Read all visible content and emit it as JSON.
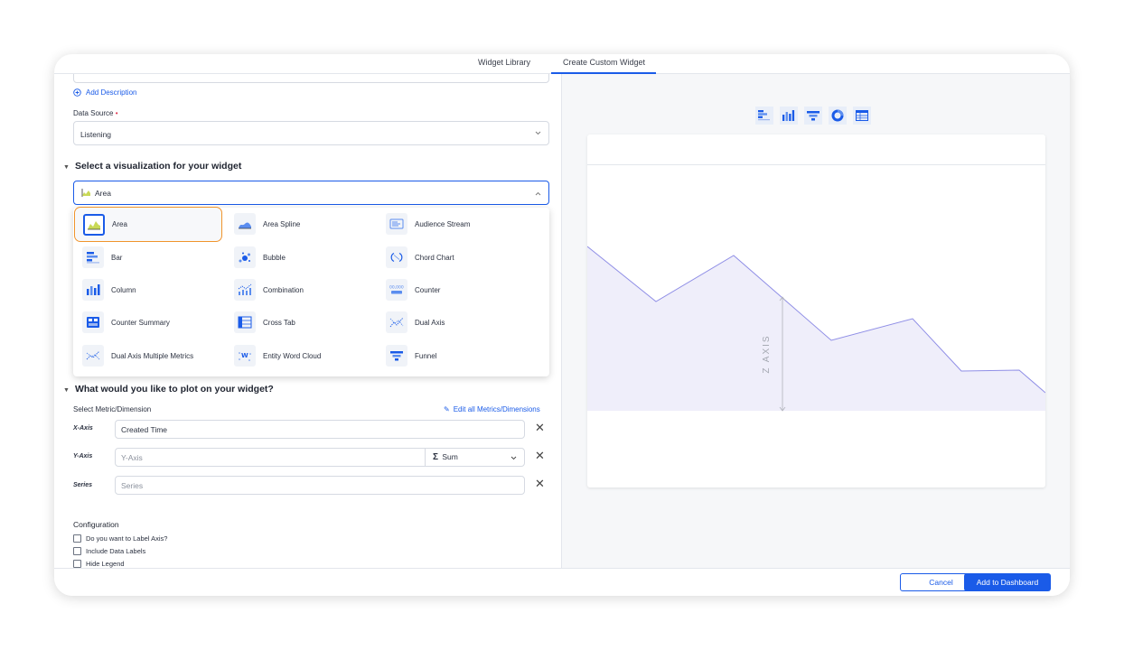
{
  "tabs": {
    "library": "Widget Library",
    "custom": "Create Custom Widget"
  },
  "form": {
    "add_description": "Add Description",
    "data_source_label": "Data Source",
    "data_source_required": "•",
    "data_source_value": "Listening",
    "viz_section_title": "Select a visualization for your widget",
    "viz_selected": "Area",
    "plot_section_title": "What would you like to plot on your widget?",
    "select_metric_label": "Select Metric/Dimension",
    "edit_all_link": "Edit all Metrics/Dimensions",
    "x_axis_label": "X-Axis",
    "x_axis_value": "Created Time",
    "y_axis_label": "Y-Axis",
    "y_axis_placeholder": "Y-Axis",
    "y_agg_symbol": "Σ",
    "y_agg_value": "Sum",
    "series_label": "Series",
    "series_placeholder": "Series",
    "config_title": "Configuration",
    "config_options": [
      "Do you want to Label Axis?",
      "Include Data Labels",
      "Hide Legend"
    ]
  },
  "viz_options": [
    {
      "label": "Area",
      "icon": "area-chart-icon"
    },
    {
      "label": "Area Spline",
      "icon": "area-spline-icon"
    },
    {
      "label": "Audience Stream",
      "icon": "audience-stream-icon"
    },
    {
      "label": "Bar",
      "icon": "bar-chart-icon"
    },
    {
      "label": "Bubble",
      "icon": "bubble-chart-icon"
    },
    {
      "label": "Chord Chart",
      "icon": "chord-chart-icon"
    },
    {
      "label": "Column",
      "icon": "column-chart-icon"
    },
    {
      "label": "Combination",
      "icon": "combination-chart-icon"
    },
    {
      "label": "Counter",
      "icon": "counter-icon"
    },
    {
      "label": "Counter Summary",
      "icon": "counter-summary-icon"
    },
    {
      "label": "Cross Tab",
      "icon": "cross-tab-icon"
    },
    {
      "label": "Dual Axis",
      "icon": "dual-axis-icon"
    },
    {
      "label": "Dual Axis Multiple Metrics",
      "icon": "dual-axis-multiple-icon"
    },
    {
      "label": "Entity Word Cloud",
      "icon": "word-cloud-icon"
    },
    {
      "label": "Funnel",
      "icon": "funnel-icon"
    }
  ],
  "preview": {
    "z_axis_label": "Z AXIS",
    "toolbar_icons": [
      "bar-icon",
      "column-icon",
      "funnel-icon",
      "donut-icon",
      "table-icon"
    ],
    "series_values": [
      79,
      51,
      72,
      43,
      26,
      38,
      46,
      58,
      64,
      43,
      22,
      17,
      11,
      10,
      9,
      6,
      0,
      11,
      12,
      14,
      16,
      18,
      20,
      22,
      24
    ],
    "accent_color": "#8f8ee6",
    "fill_color": "#efeefa"
  },
  "footer": {
    "cancel": "Cancel",
    "add": "Add to Dashboard"
  },
  "colors": {
    "primary": "#1a5be8",
    "selected_outline": "#f0942c"
  }
}
